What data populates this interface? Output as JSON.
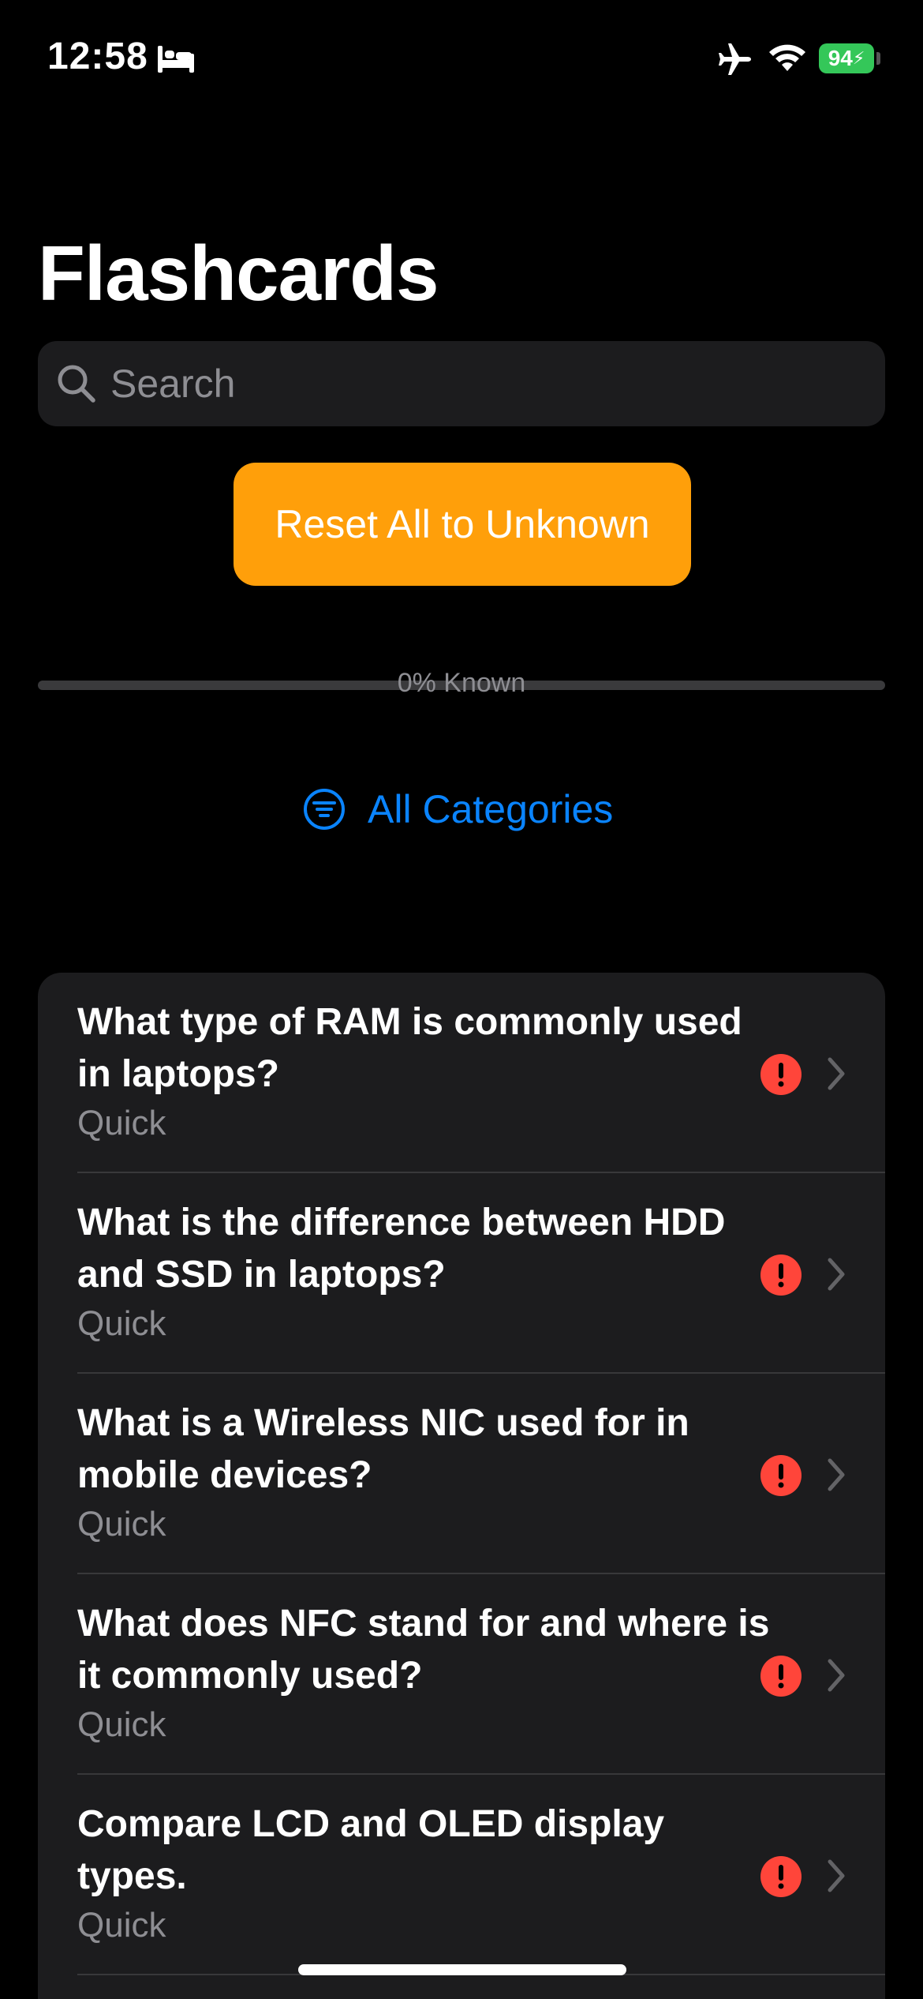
{
  "status_bar": {
    "time": "12:58",
    "battery": "94"
  },
  "title": "Flashcards",
  "search": {
    "placeholder": "Search",
    "value": ""
  },
  "reset_button": "Reset All to Unknown",
  "progress": {
    "label": "0% Known",
    "known_fraction": 0
  },
  "categories_button": "All Categories",
  "colors": {
    "accent": "#0a84ff",
    "button": "#ff9f0a",
    "alert": "#ff453a",
    "battery": "#34c759"
  },
  "cards": [
    {
      "question": "What type of RAM is commonly used in laptops?",
      "category": "Quick"
    },
    {
      "question": "What is the difference between HDD and SSD in laptops?",
      "category": "Quick"
    },
    {
      "question": "What is a Wireless NIC used for in mobile devices?",
      "category": "Quick"
    },
    {
      "question": "What does NFC stand for and where is it commonly used?",
      "category": "Quick"
    },
    {
      "question": "Compare LCD and OLED display types.",
      "category": "Quick"
    }
  ]
}
